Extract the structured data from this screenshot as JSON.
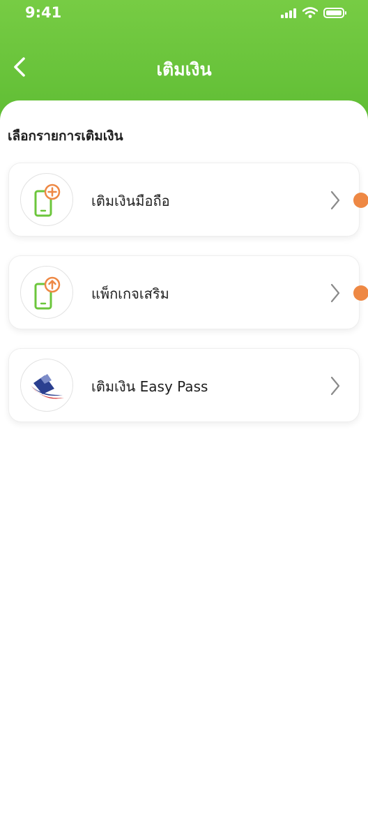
{
  "status_bar": {
    "time": "9:41"
  },
  "header": {
    "title": "เติมเงิน",
    "back_icon": "chevron-left-icon"
  },
  "section_title": "เลือกรายการเติมเงิน",
  "items": [
    {
      "label": "เติมเงินมือถือ",
      "icon": "phone-plus-icon",
      "has_badge": true
    },
    {
      "label": "แพ็กเกจเสริม",
      "icon": "phone-upload-icon",
      "has_badge": true
    },
    {
      "label": "เติมเงิน Easy Pass",
      "icon": "easy-pass-logo",
      "has_badge": false
    }
  ],
  "colors": {
    "header_green": "#6cc63c",
    "accent_orange": "#ee8844",
    "icon_green": "#6cc63c",
    "chevron_gray": "#8a8a8a"
  }
}
